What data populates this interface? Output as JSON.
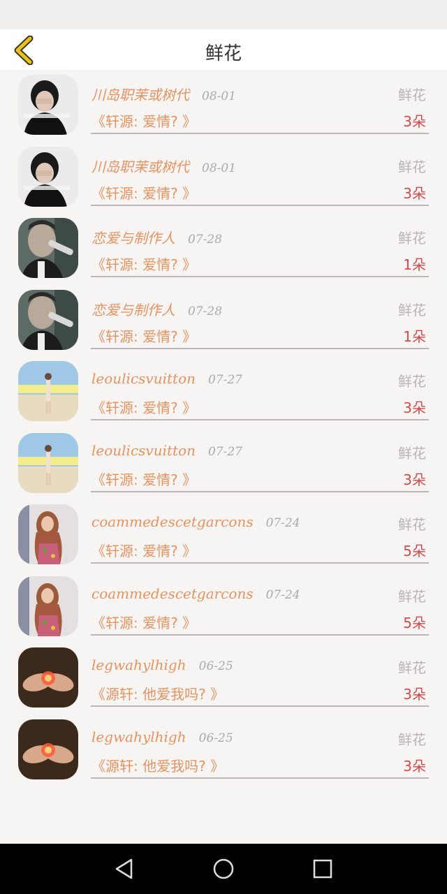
{
  "header": {
    "title": "鲜花"
  },
  "rows": [
    {
      "name": "川岛职茉或树代",
      "date": "08-01",
      "type": "鲜花",
      "message": "《轩源: 爱情? 》",
      "count": "3朵",
      "avatar": "man-face-cover"
    },
    {
      "name": "川岛职茉或树代",
      "date": "08-01",
      "type": "鲜花",
      "message": "《轩源: 爱情? 》",
      "count": "3朵",
      "avatar": "man-face-cover"
    },
    {
      "name": "恋爱与制作人",
      "date": "07-28",
      "type": "鲜花",
      "message": "《轩源: 爱情? 》",
      "count": "1朵",
      "avatar": "man-drinking"
    },
    {
      "name": "恋爱与制作人",
      "date": "07-28",
      "type": "鲜花",
      "message": "《轩源: 爱情? 》",
      "count": "1朵",
      "avatar": "man-drinking"
    },
    {
      "name": "leoulicsvuitton",
      "date": "07-27",
      "type": "鲜花",
      "message": "《轩源: 爱情? 》",
      "count": "3朵",
      "avatar": "girl-sky"
    },
    {
      "name": "leoulicsvuitton",
      "date": "07-27",
      "type": "鲜花",
      "message": "《轩源: 爱情? 》",
      "count": "3朵",
      "avatar": "girl-sky"
    },
    {
      "name": "coammedescetgarcons",
      "date": "07-24",
      "type": "鲜花",
      "message": "《轩源: 爱情? 》",
      "count": "5朵",
      "avatar": "girl-dress"
    },
    {
      "name": "coammedescetgarcons",
      "date": "07-24",
      "type": "鲜花",
      "message": "《轩源: 爱情? 》",
      "count": "5朵",
      "avatar": "girl-dress"
    },
    {
      "name": "legwahylhigh",
      "date": "06-25",
      "type": "鲜花",
      "message": "《源轩: 他爱我吗? 》",
      "count": "3朵",
      "avatar": "hands-light"
    },
    {
      "name": "legwahylhigh",
      "date": "06-25",
      "type": "鲜花",
      "message": "《源轩: 他爱我吗? 》",
      "count": "3朵",
      "avatar": "hands-light"
    }
  ],
  "icons": {
    "back": "chevron-left-icon",
    "nav_back": "triangle-back-icon",
    "nav_home": "circle-home-icon",
    "nav_recent": "square-recent-icon"
  },
  "colors": {
    "accent": "#e8935f",
    "count": "#d64a4a",
    "back_chevron": "#e6c21a"
  }
}
